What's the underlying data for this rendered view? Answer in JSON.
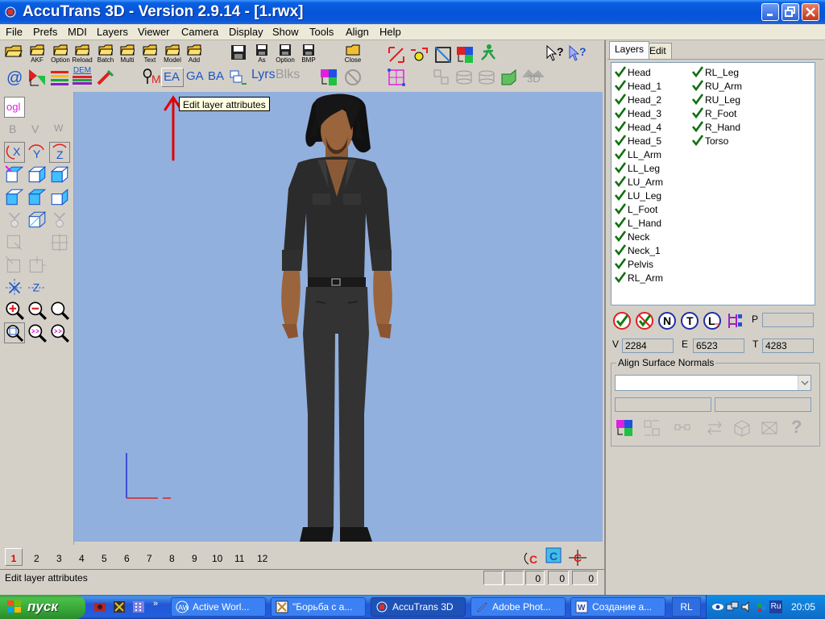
{
  "window": {
    "title": "AccuTrans 3D - Version 2.9.14 - [1.rwx]"
  },
  "menu": [
    "File",
    "Prefs",
    "MDI",
    "Layers",
    "Viewer",
    "Camera",
    "Display",
    "Show",
    "Tools",
    "Align",
    "Help"
  ],
  "toolbar": {
    "row1_labels": [
      "AKF",
      "Option",
      "Reload",
      "Batch",
      "Multi",
      "Text",
      "Model",
      "Add",
      "As",
      "Option",
      "BMP",
      "Close"
    ],
    "row2_text": {
      "ea": "EA",
      "ga": "GA",
      "ba": "BA",
      "lyrs": "Lyrs",
      "blks": "Blks",
      "m": "M",
      "threed": "3D"
    },
    "dem_label": "DEM"
  },
  "tooltip": "Edit layer attributes",
  "left_palette": {
    "ogl": "ogl",
    "b": "B",
    "v": "V",
    "w": "W",
    "x": "X",
    "y": "Y",
    "z": "Z"
  },
  "right_panel": {
    "tabs": [
      "Layers",
      "Edit"
    ],
    "layers_col1": [
      "Head",
      "Head_1",
      "Head_2",
      "Head_3",
      "Head_4",
      "Head_5",
      "LL_Arm",
      "LL_Leg",
      "LU_Arm",
      "LU_Leg",
      "L_Foot",
      "L_Hand",
      "Neck",
      "Neck_1",
      "Pelvis",
      "RL_Arm"
    ],
    "layers_col2": [
      "RL_Leg",
      "RU_Arm",
      "RU_Leg",
      "R_Foot",
      "R_Hand",
      "Torso"
    ],
    "p_label": "P",
    "btn_n": "N",
    "btn_t": "T",
    "btn_l": "L",
    "v_label": "V",
    "v_value": "2284",
    "e_label": "E",
    "e_value": "6523",
    "t_label": "T",
    "t_value": "4283",
    "align_title": "Align Surface Normals"
  },
  "pages": [
    "1",
    "2",
    "3",
    "4",
    "5",
    "6",
    "7",
    "8",
    "9",
    "10",
    "11",
    "12"
  ],
  "status": {
    "text": "Edit layer attributes",
    "v1": "0",
    "v2": "0",
    "v3": "0"
  },
  "taskbar": {
    "start": "пуск",
    "tasks": [
      "Active Worl...",
      "\"Борьба с а...",
      "AccuTrans 3D",
      "Adobe Phot...",
      "Создание а..."
    ],
    "lang": "RL",
    "tray_lang": "Ru",
    "clock": "20:05"
  },
  "colors": {
    "viewport_bg": "#92b0dd",
    "annotation_arrow": "#e00000",
    "taskbar": "#245edb"
  }
}
